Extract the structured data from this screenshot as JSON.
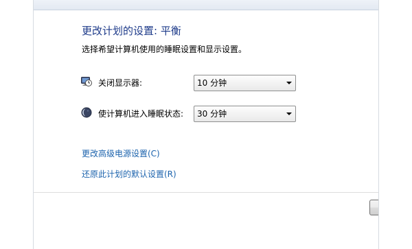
{
  "header": {
    "title": "更改计划的设置: 平衡",
    "subtitle": "选择希望计算机使用的睡眠设置和显示设置。"
  },
  "settings": [
    {
      "label": "关闭显示器:",
      "value": "10 分钟",
      "icon": "monitor-clock-icon"
    },
    {
      "label": "使计算机进入睡眠状态:",
      "value": "30 分钟",
      "icon": "moon-icon"
    }
  ],
  "links": {
    "advanced": "更改高级电源设置(C)",
    "restore": "还原此计划的默认设置(R)"
  },
  "colors": {
    "title": "#1e3b8a",
    "link": "#1c63ad"
  }
}
